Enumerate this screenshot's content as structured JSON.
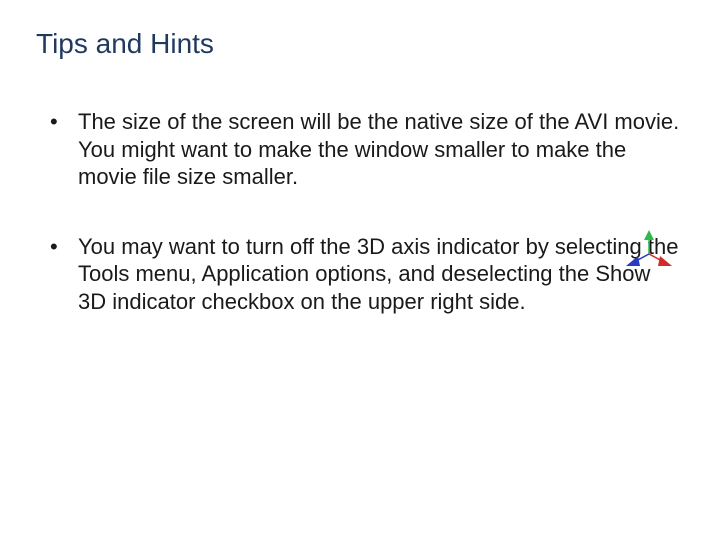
{
  "slide": {
    "title": "Tips and Hints",
    "bullets": [
      "The size of the screen will be the native size of the AVI movie. You might want to make the window smaller to make the movie file size smaller.",
      "You may want to turn off the 3D axis indicator by selecting the Tools menu, Application options, and deselecting the Show 3D indicator checkbox on the upper right side."
    ]
  },
  "axis_colors": {
    "y": "#2fb84e",
    "x": "#d42a2a",
    "z": "#2a3cc2"
  }
}
